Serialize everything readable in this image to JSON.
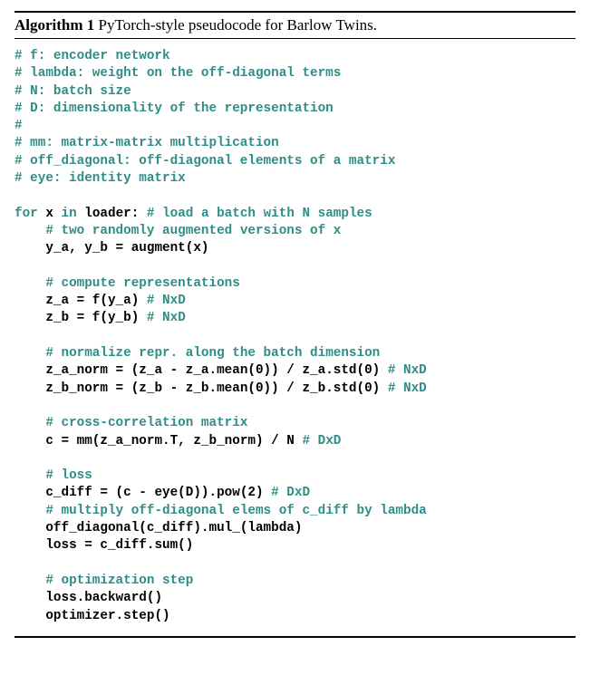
{
  "algorithm": {
    "number_label": "Algorithm 1",
    "caption": " PyTorch-style pseudocode for Barlow Twins."
  },
  "code": {
    "hdr_f": "# f: encoder network",
    "hdr_lambda": "# lambda: weight on the off-diagonal terms",
    "hdr_N": "# N: batch size",
    "hdr_D": "# D: dimensionality of the representation",
    "hdr_blank": "#",
    "hdr_mm": "# mm: matrix-matrix multiplication",
    "hdr_offdiag": "# off_diagonal: off-diagonal elements of a matrix",
    "hdr_eye": "# eye: identity matrix",
    "kw_for": "for",
    "var_x": " x ",
    "kw_in": "in",
    "rest_for": " loader: ",
    "cmt_for": "# load a batch with N samples",
    "indent": "    ",
    "cmt_aug": "# two randomly augmented versions of x",
    "line_aug": "y_a, y_b = augment(x)",
    "cmt_repr": "# compute representations",
    "line_za": "z_a = f(y_a) ",
    "cmt_za": "# NxD",
    "line_zb": "z_b = f(y_b) ",
    "cmt_zb": "# NxD",
    "cmt_norm": "# normalize repr. along the batch dimension",
    "line_zan": "z_a_norm = (z_a - z_a.mean(0)) / z_a.std(0) ",
    "cmt_zan": "# NxD",
    "line_zbn": "z_b_norm = (z_b - z_b.mean(0)) / z_b.std(0) ",
    "cmt_zbn": "# NxD",
    "cmt_cc": "# cross-correlation matrix",
    "line_cc": "c = mm(z_a_norm.T, z_b_norm) / N ",
    "cmt_cc2": "# DxD",
    "cmt_loss": "# loss",
    "line_cdiff": "c_diff = (c - eye(D)).pow(2) ",
    "cmt_cdiff": "# DxD",
    "cmt_mul": "# multiply off-diagonal elems of c_diff by lambda",
    "line_offdiag": "off_diagonal(c_diff).mul_(lambda)",
    "line_losssum": "loss = c_diff.sum()",
    "cmt_opt": "# optimization step",
    "line_back": "loss.backward()",
    "line_step": "optimizer.step()"
  }
}
